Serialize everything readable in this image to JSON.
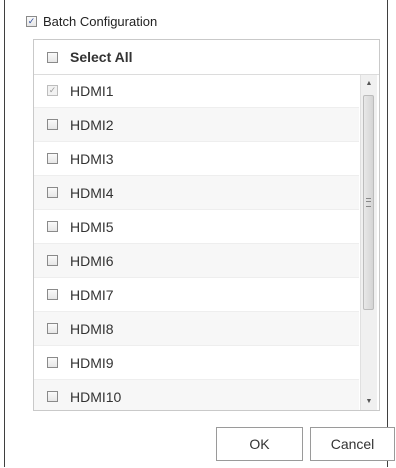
{
  "batch": {
    "label": "Batch Configuration",
    "checked": true
  },
  "list": {
    "select_all_label": "Select All",
    "items": [
      {
        "label": "HDMI1",
        "checked": true,
        "disabled": true
      },
      {
        "label": "HDMI2",
        "checked": false
      },
      {
        "label": "HDMI3",
        "checked": false
      },
      {
        "label": "HDMI4",
        "checked": false
      },
      {
        "label": "HDMI5",
        "checked": false
      },
      {
        "label": "HDMI6",
        "checked": false
      },
      {
        "label": "HDMI7",
        "checked": false
      },
      {
        "label": "HDMI8",
        "checked": false
      },
      {
        "label": "HDMI9",
        "checked": false
      },
      {
        "label": "HDMI10",
        "checked": false
      }
    ]
  },
  "buttons": {
    "ok": "OK",
    "cancel": "Cancel"
  },
  "icons": {
    "scroll_up": "scroll-up-arrow",
    "scroll_down": "scroll-down-arrow",
    "scroll_grip": "scroll-grip"
  }
}
